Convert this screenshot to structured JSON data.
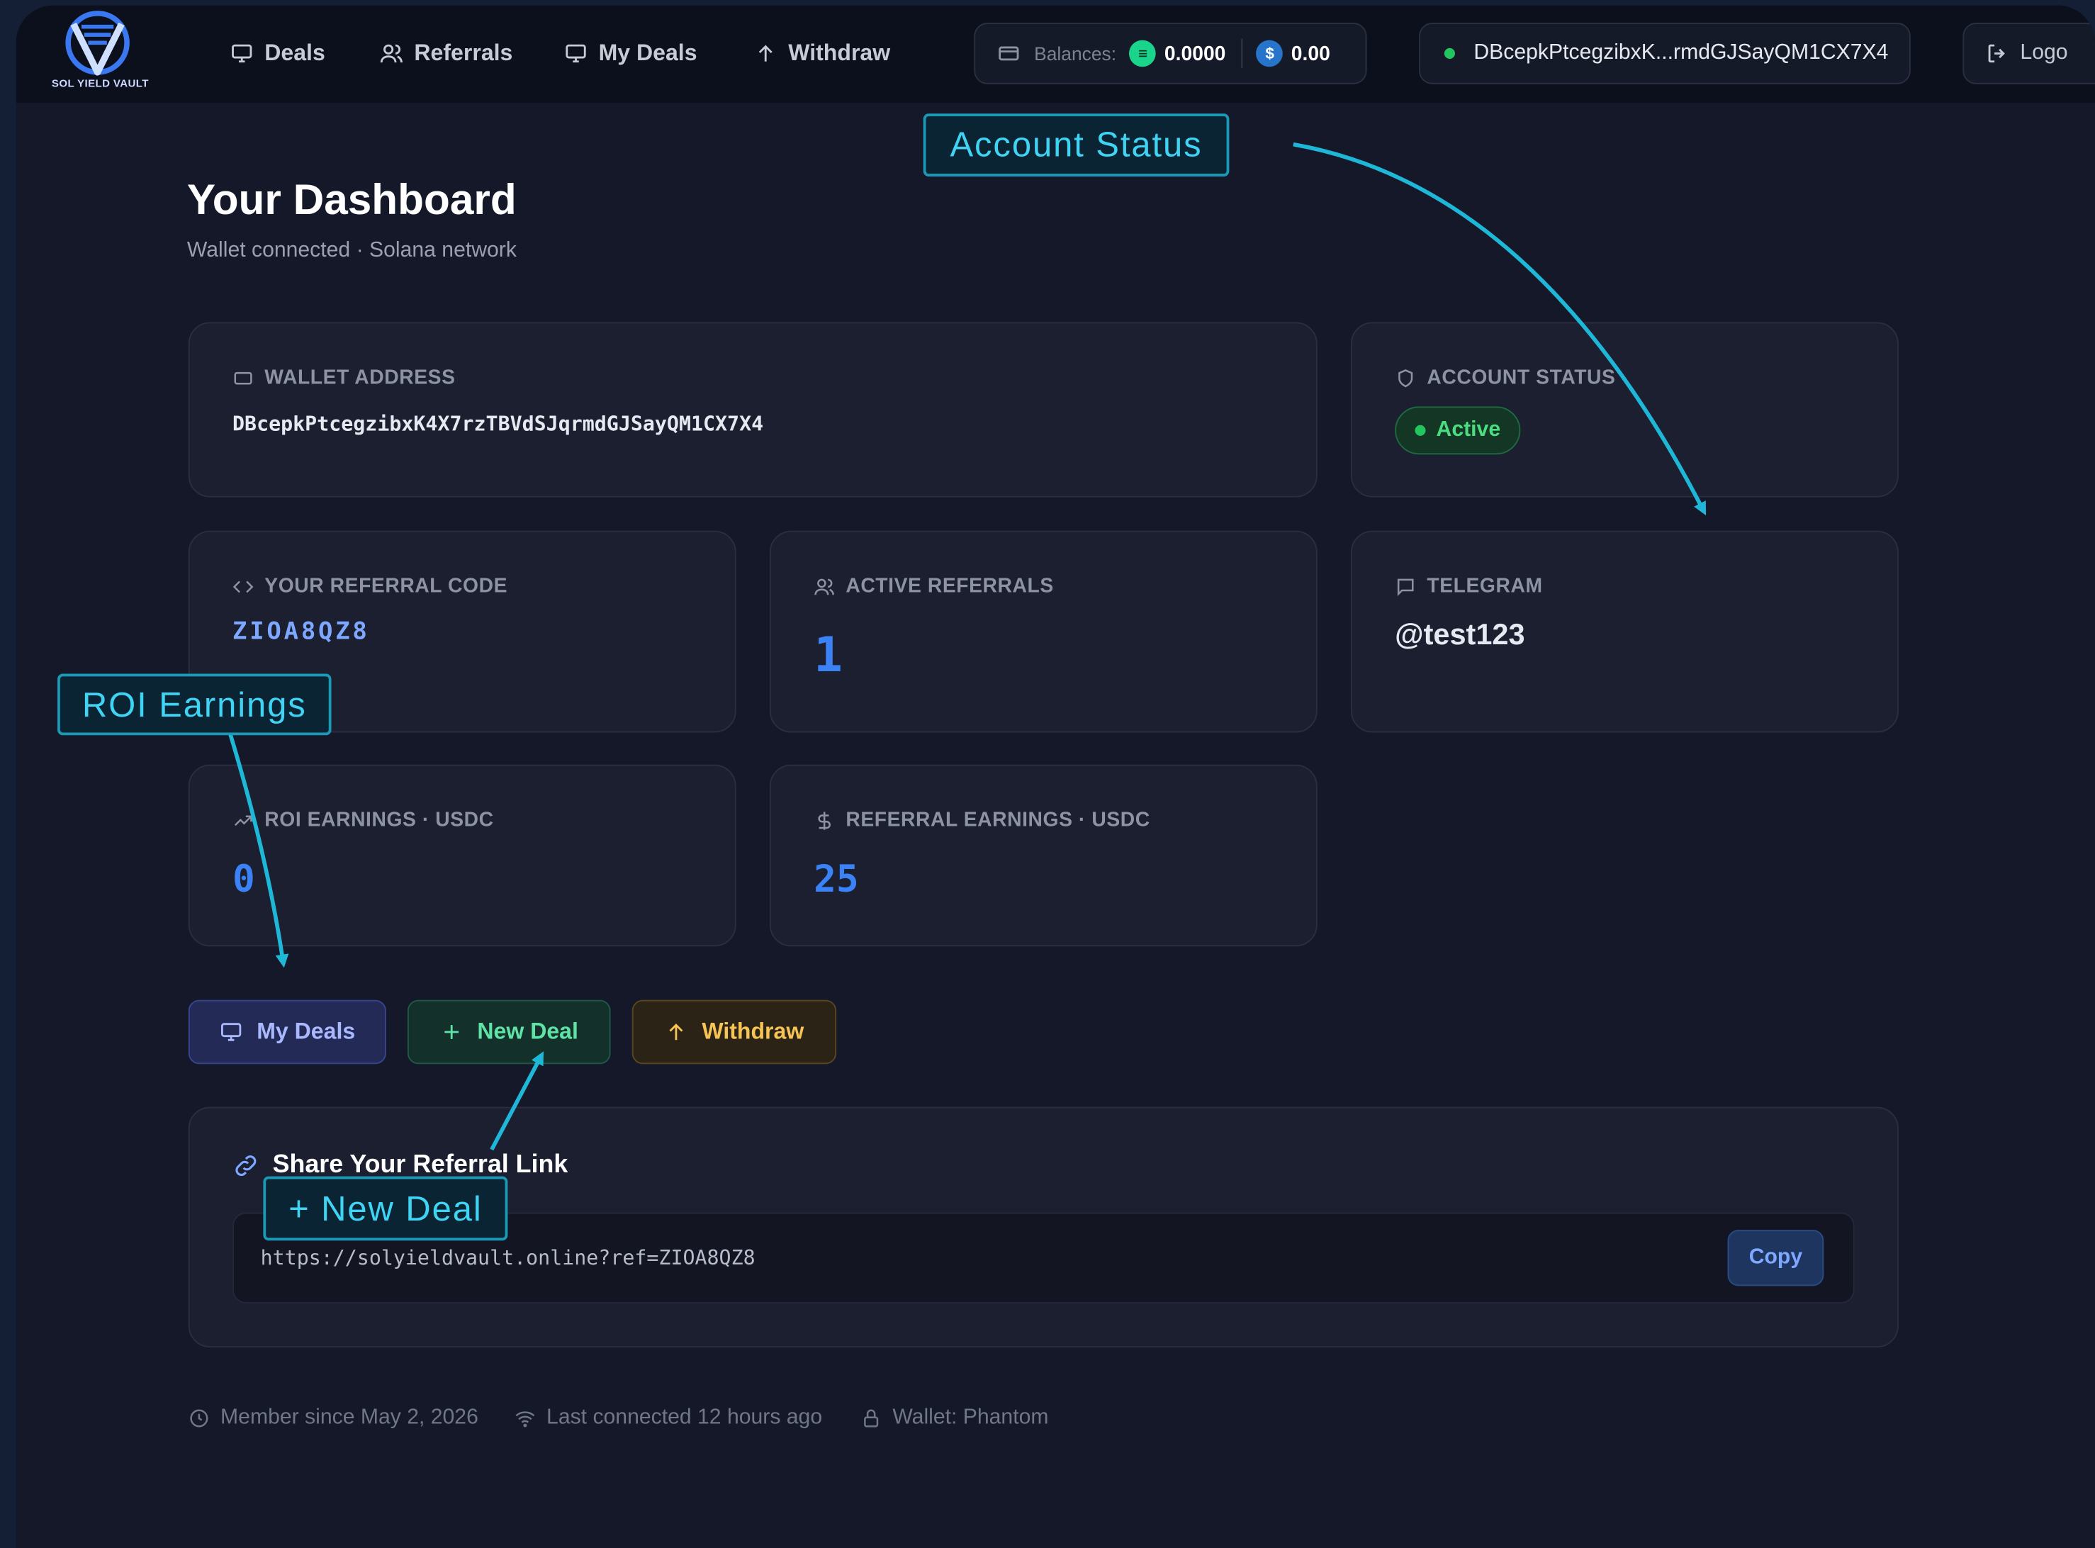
{
  "app": {
    "logo_text": "SOL YIELD VAULT"
  },
  "nav": {
    "items": [
      {
        "label": "Deals",
        "icon": "monitor-icon"
      },
      {
        "label": "Referrals",
        "icon": "users-icon"
      },
      {
        "label": "My Deals",
        "icon": "monitor-icon"
      },
      {
        "label": "Withdraw",
        "icon": "arrow-up-icon"
      }
    ],
    "balances_label": "Balances:",
    "sol_balance": "0.0000",
    "usdc_balance": "0.00",
    "wallet_short": "DBcepkPtcegzibxK...rmdGJSayQM1CX7X4",
    "logout_label": "Logo"
  },
  "header": {
    "title": "Your Dashboard",
    "subtitle": "Wallet connected · Solana network"
  },
  "cards": {
    "wallet": {
      "label": "Wallet Address",
      "value": "DBcepkPtcegzibxK4X7rzTBVdSJqrmdGJSayQM1CX7X4"
    },
    "status": {
      "label": "Account Status",
      "value": "Active"
    },
    "referral_code": {
      "label": "Your Referral Code",
      "value": "ZIOA8QZ8"
    },
    "active_referrals": {
      "label": "Active Referrals",
      "value": "1"
    },
    "telegram": {
      "label": "Telegram",
      "value": "@test123"
    },
    "roi": {
      "label": "ROI Earnings · USDC",
      "value": "0"
    },
    "referral_earnings": {
      "label": "Referral Earnings · USDC",
      "value": "25"
    }
  },
  "actions": {
    "my_deals": "My Deals",
    "new_deal": "New Deal",
    "withdraw": "Withdraw"
  },
  "share": {
    "title": "Share Your Referral Link",
    "link": "https://solyieldvault.online?ref=ZIOA8QZ8",
    "copy": "Copy"
  },
  "footer": {
    "member_since": "Member since May 2, 2026",
    "last_connected": "Last connected 12 hours ago",
    "wallet": "Wallet: Phantom"
  },
  "callouts": {
    "account_status": "Account Status",
    "roi_earnings": "ROI Earnings",
    "new_deal": "+ New Deal"
  },
  "colors": {
    "accent_blue": "#3b82f6",
    "active_green": "#22c55e",
    "callout_cyan": "#1fb7d8"
  }
}
